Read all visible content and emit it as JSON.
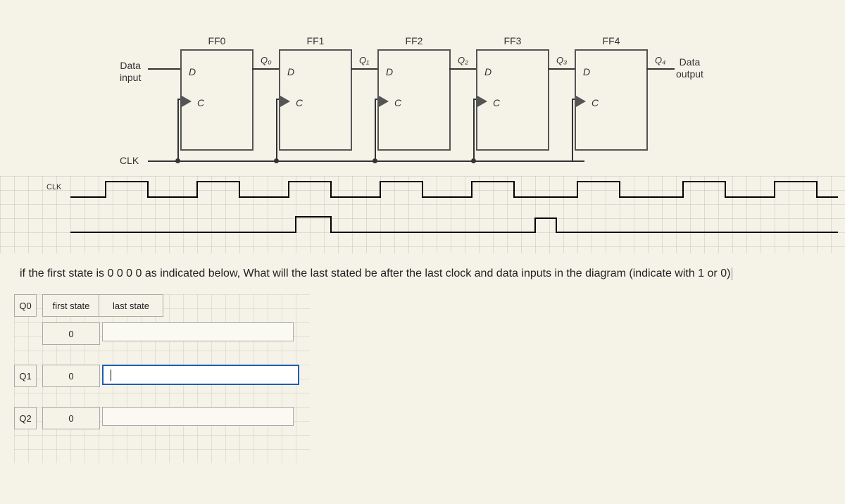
{
  "diagram": {
    "data_input_label": "Data\ninput",
    "data_output_label": "Data\noutput",
    "clk_label": "CLK",
    "flipflops": [
      {
        "name": "FF0",
        "d": "D",
        "c": "C",
        "q": "Q₀"
      },
      {
        "name": "FF1",
        "d": "D",
        "c": "C",
        "q": "Q₁"
      },
      {
        "name": "FF2",
        "d": "D",
        "c": "C",
        "q": "Q₂"
      },
      {
        "name": "FF3",
        "d": "D",
        "c": "C",
        "q": "Q₃"
      },
      {
        "name": "FF4",
        "d": "D",
        "c": "C",
        "q": "Q₄"
      }
    ]
  },
  "timing": {
    "row_label": "CLK"
  },
  "question_text": "if the first state is 0 0 0 0 as indicated below, What will the last stated be after the last clock and data inputs in the diagram (indicate with 1 or 0)",
  "table": {
    "header_first": "first state",
    "header_last": "last state",
    "rows": [
      {
        "label": "Q0",
        "first": "0",
        "last": ""
      },
      {
        "label": "Q1",
        "first": "0",
        "last": ""
      },
      {
        "label": "Q2",
        "first": "0",
        "last": ""
      }
    ]
  }
}
